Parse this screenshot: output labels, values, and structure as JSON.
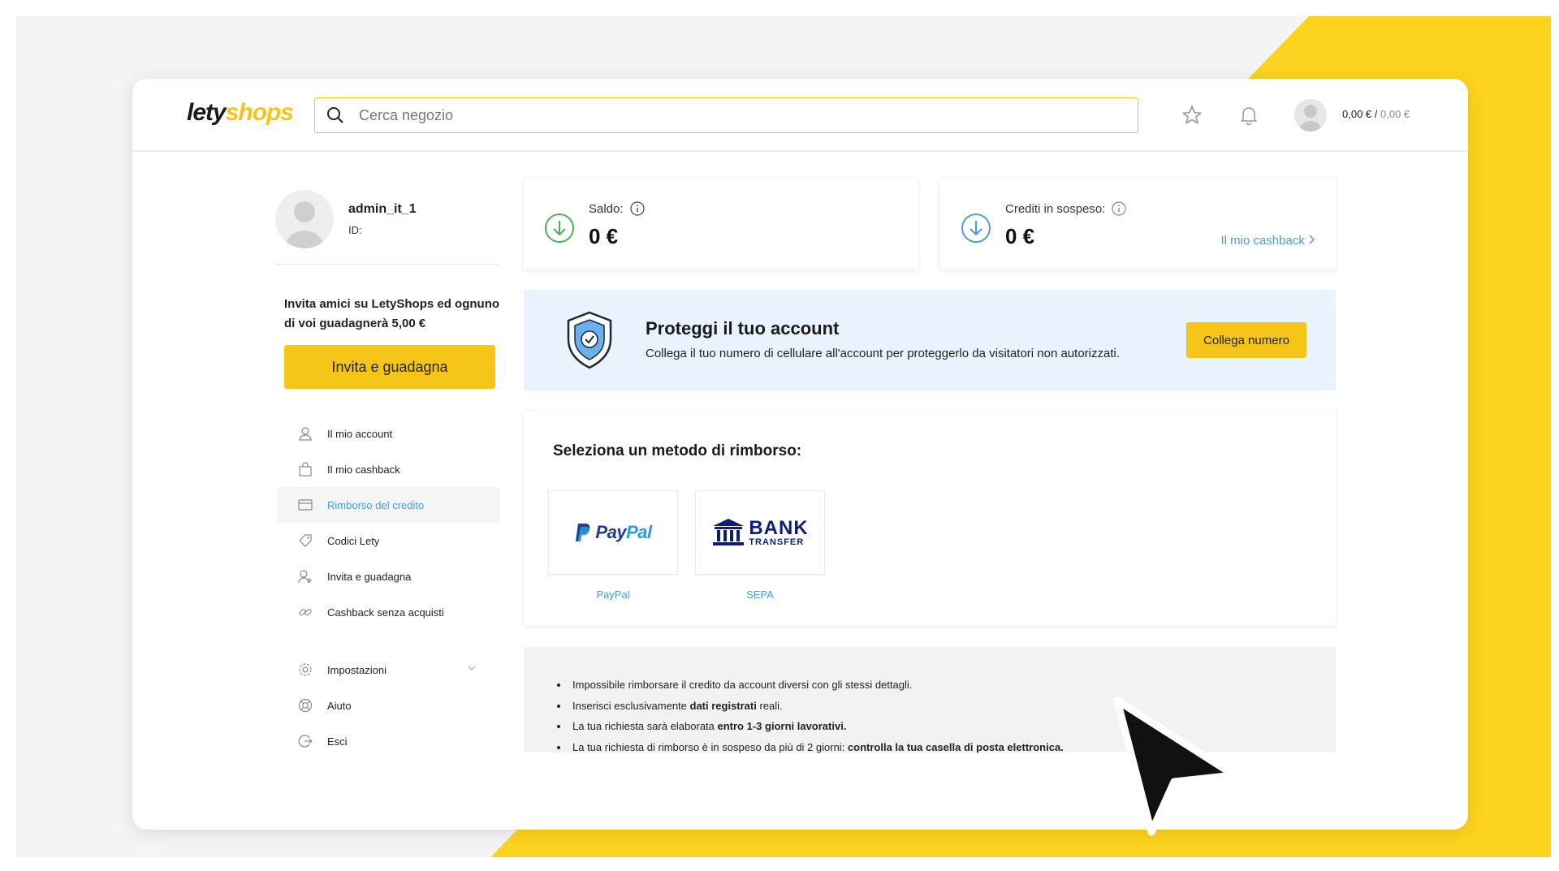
{
  "colors": {
    "brand_yellow": "#f5c518",
    "link_blue": "#4a9be0",
    "protect_bg": "#e8f3fd",
    "success_green": "#4caf50"
  },
  "header": {
    "logo_part1": "lety",
    "logo_part2": "shops",
    "search_placeholder": "Cerca negozio",
    "balance_main": "0,00 €",
    "balance_sep": " / ",
    "balance_pending": "0,00 €",
    "icons": [
      "search-icon",
      "star-icon",
      "bell-icon",
      "avatar"
    ]
  },
  "profile": {
    "username": "admin_it_1",
    "id_label": "ID:"
  },
  "invite": {
    "text": "Invita amici su LetyShops ed ognuno di voi guadagnerà 5,00 €",
    "button": "Invita e guadagna"
  },
  "menu": {
    "items": [
      {
        "label": "Il mio account",
        "icon": "user-icon"
      },
      {
        "label": "Il mio cashback",
        "icon": "bag-icon"
      },
      {
        "label": "Rimborso del credito",
        "icon": "wallet-icon",
        "active": true
      },
      {
        "label": "Codici Lety",
        "icon": "tag-icon"
      },
      {
        "label": "Invita e guadagna",
        "icon": "user-plus-icon"
      },
      {
        "label": "Cashback senza acquisti",
        "icon": "link-icon"
      }
    ],
    "bottom": [
      {
        "label": "Impostazioni",
        "icon": "gear-icon"
      },
      {
        "label": "Aiuto",
        "icon": "lifebuoy-icon"
      },
      {
        "label": "Esci",
        "icon": "logout-icon"
      }
    ]
  },
  "stats": {
    "balance": {
      "label": "Saldo:",
      "value": "0 €"
    },
    "pending": {
      "label": "Crediti in sospeso:",
      "value": "0 €",
      "link": "Il mio cashback"
    }
  },
  "protect": {
    "title": "Proteggi il tuo account",
    "text": "Collega il tuo numero di cellulare all'account per proteggerlo da visitatori non autorizzati.",
    "button": "Collega numero"
  },
  "refund": {
    "title": "Seleziona un metodo di rimborso:",
    "methods": [
      {
        "label": "PayPal",
        "logo_text": "PayPal"
      },
      {
        "label": "SEPA",
        "logo_line1": "BANK",
        "logo_line2": "TRANSFER"
      }
    ]
  },
  "notes": [
    {
      "pre": "Impossibile rimborsare il credito da account diversi con gli stessi dettagli.",
      "bold": "",
      "post": ""
    },
    {
      "pre": "Inserisci esclusivamente ",
      "bold": "dati registrati",
      "post": " reali."
    },
    {
      "pre": "La tua richiesta sarà elaborata ",
      "bold": "entro 1-3 giorni lavorativi.",
      "post": ""
    },
    {
      "pre": "La tua richiesta di rimborso è in sospeso da più di 2 giorni: ",
      "bold": "controlla la tua casella di posta elettronica.",
      "post": ""
    }
  ]
}
